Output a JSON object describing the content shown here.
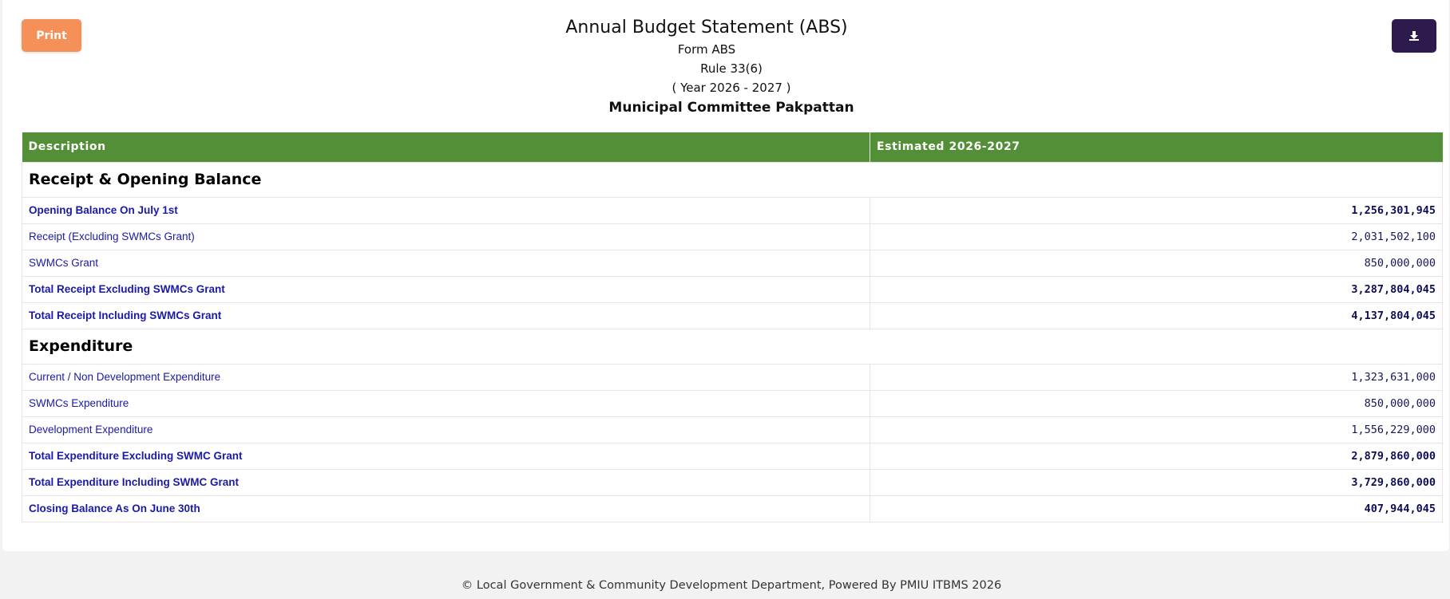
{
  "toolbar": {
    "print_label": "Print",
    "download_icon": "download-icon"
  },
  "header": {
    "title": "Annual Budget Statement (ABS)",
    "form": "Form ABS",
    "rule": "Rule 33(6)",
    "year": "( Year 2026 - 2027 )",
    "org": "Municipal Committee Pakpattan"
  },
  "table": {
    "col_description": "Description",
    "col_estimated": "Estimated 2026-2027",
    "receipt_section": "Receipt & Opening Balance",
    "receipt_rows": [
      {
        "label": "Opening Balance On July 1st",
        "value": "1,256,301,945"
      },
      {
        "label": "Receipt (Excluding SWMCs Grant)",
        "value": "2,031,502,100"
      },
      {
        "label": "SWMCs Grant",
        "value": "850,000,000"
      },
      {
        "label": "Total Receipt Excluding SWMCs Grant",
        "value": "3,287,804,045"
      },
      {
        "label": "Total Receipt Including SWMCs Grant",
        "value": "4,137,804,045"
      }
    ],
    "expenditure_section": "Expenditure",
    "expenditure_rows": [
      {
        "label": "Current / Non Development Expenditure",
        "value": "1,323,631,000"
      },
      {
        "label": "SWMCs Expenditure",
        "value": "850,000,000"
      },
      {
        "label": "Development Expenditure",
        "value": "1,556,229,000"
      },
      {
        "label": "Total Expenditure Excluding SWMC Grant",
        "value": "2,879,860,000"
      },
      {
        "label": "Total Expenditure Including SWMC Grant",
        "value": "3,729,860,000"
      },
      {
        "label": "Closing Balance As On June 30th",
        "value": "407,944,045"
      }
    ]
  },
  "footer": {
    "text": "© Local Government & Community Development Department, Powered By PMIU ITBMS 2026"
  },
  "colors": {
    "header_green": "#528f37",
    "print_orange": "#f59158",
    "download_purple": "#2d1b4e",
    "link_blue": "#1a1aa8"
  }
}
